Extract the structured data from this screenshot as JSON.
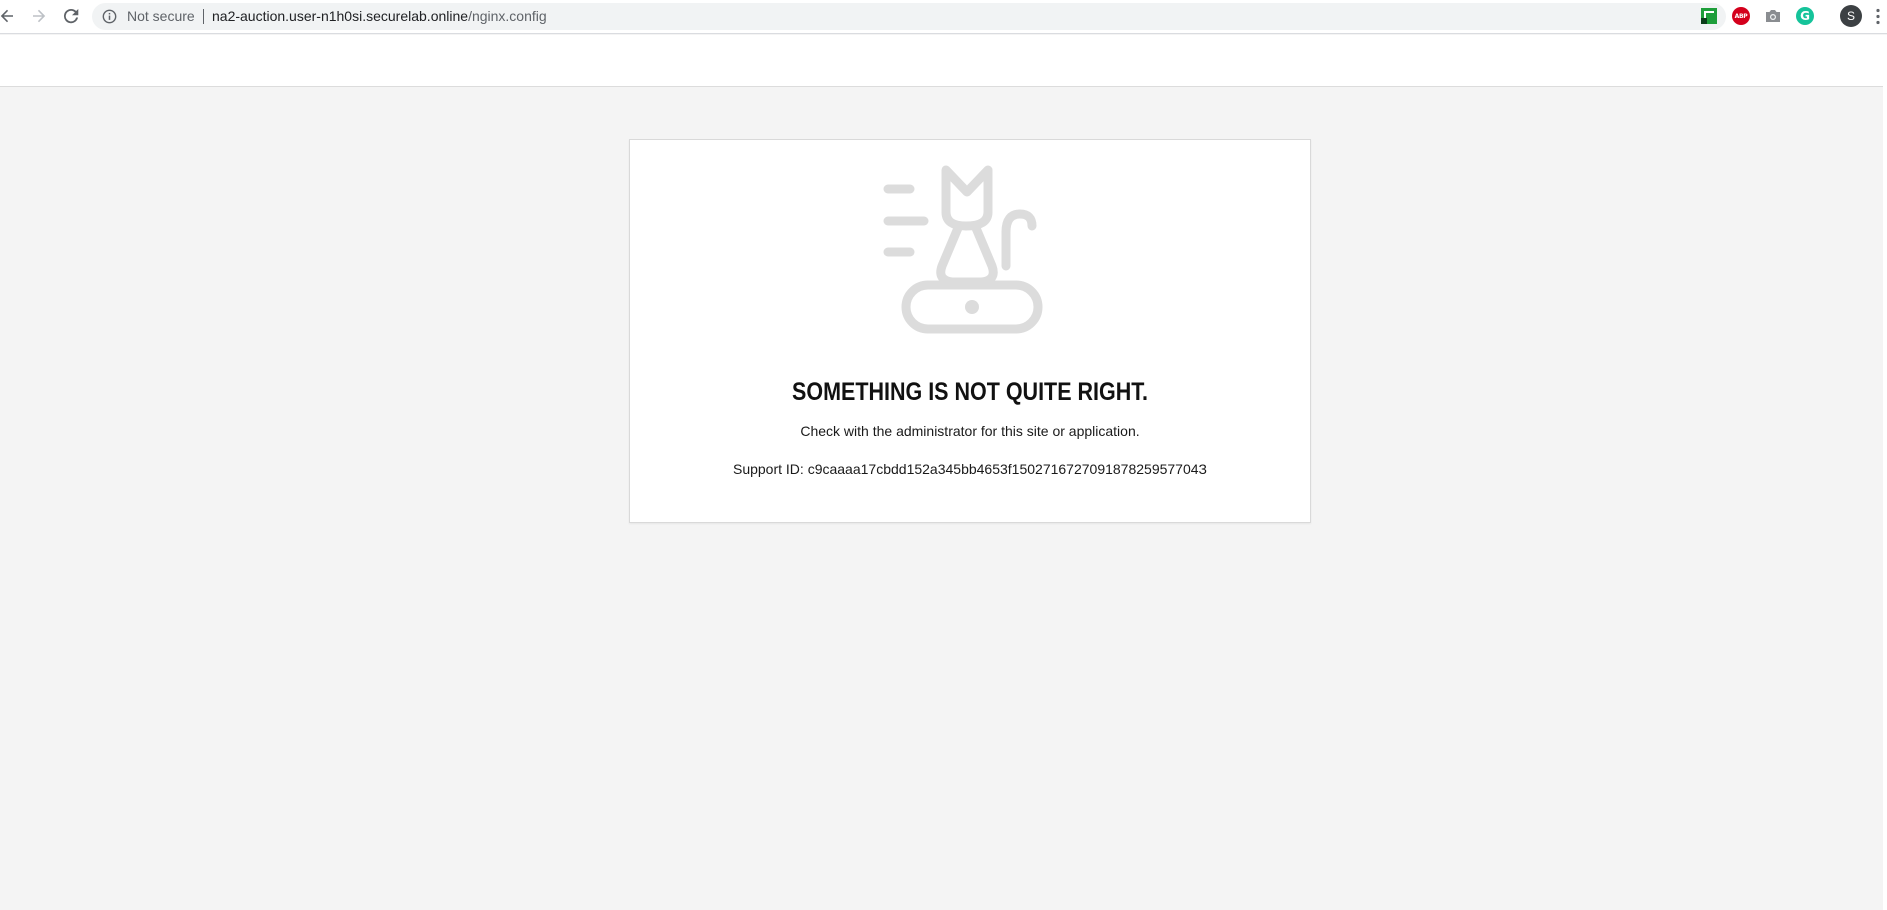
{
  "browser": {
    "security_label": "Not secure",
    "url_host": "na2-auction.user-n1h0si.securelab.online",
    "url_path": "/nginx.config",
    "profile_initial": "S",
    "extensions": [
      {
        "name": "green-extension-icon"
      },
      {
        "name": "adblock-plus-icon",
        "label": "ABP",
        "color": "#d4001c"
      },
      {
        "name": "camera-icon"
      },
      {
        "name": "grammarly-icon",
        "label": "G",
        "color": "#15c39a"
      }
    ]
  },
  "error": {
    "title": "SOMETHING IS NOT QUITE RIGHT.",
    "message": "Check with the administrator for this site or application.",
    "support_label": "Support ID:",
    "support_id": "c9caaaa17cbdd152a345bb4653f150271672709187825957704З"
  },
  "colors": {
    "page_background": "#f4f4f4",
    "card_background": "#ffffff",
    "illustration": "#dcdcdc",
    "title": "#111111"
  }
}
